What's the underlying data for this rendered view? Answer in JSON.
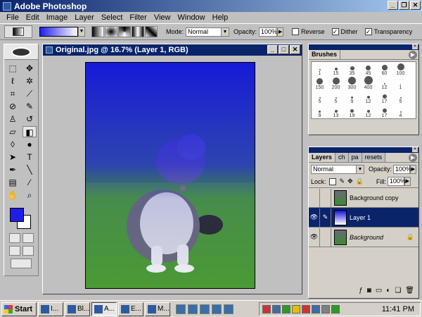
{
  "app": {
    "title": "Adobe Photoshop"
  },
  "menu": [
    "File",
    "Edit",
    "Image",
    "Layer",
    "Select",
    "Filter",
    "View",
    "Window",
    "Help"
  ],
  "options": {
    "mode_label": "Mode:",
    "mode_value": "Normal",
    "opacity_label": "Opacity:",
    "opacity_value": "100%",
    "reverse_label": "Reverse",
    "dither_label": "Dither",
    "transparency_label": "Transparency",
    "reverse_checked": false,
    "dither_checked": true,
    "transparency_checked": true
  },
  "colors": {
    "foreground": "#1e1ee8",
    "background": "#ffffff",
    "titlebar": "#0a246a"
  },
  "document": {
    "title": "Original.jpg @ 16.7% (Layer 1, RGB)"
  },
  "brushes": {
    "tab": "Brushes",
    "rows": [
      [
        "1",
        "15",
        "35",
        "45",
        "60",
        "100"
      ],
      [
        "150",
        "200",
        "300",
        "400",
        "12",
        "1"
      ],
      [
        "5",
        "5",
        "9",
        "12",
        "17",
        "5"
      ],
      [
        "9",
        "13",
        "19",
        "12",
        "17",
        "4"
      ]
    ]
  },
  "layers_panel": {
    "tabs": [
      "Layers",
      "ch",
      "pa",
      "resets"
    ],
    "blend_mode": "Normal",
    "opacity_label": "Opacity:",
    "opacity_value": "100%",
    "lock_label": "Lock:",
    "fill_label": "Fill:",
    "fill_value": "100%",
    "layers": [
      {
        "name": "Background copy",
        "visible": false,
        "selected": false
      },
      {
        "name": "Layer 1",
        "visible": true,
        "selected": true
      },
      {
        "name": "Background",
        "visible": true,
        "selected": false,
        "locked": true
      }
    ]
  },
  "taskbar": {
    "start": "Start",
    "buttons": [
      {
        "label": "I...",
        "active": false
      },
      {
        "label": "Bl...",
        "active": false
      },
      {
        "label": "A...",
        "active": true
      },
      {
        "label": "E...",
        "active": false
      },
      {
        "label": "M...",
        "active": false
      }
    ],
    "clock": "11:41 PM"
  }
}
